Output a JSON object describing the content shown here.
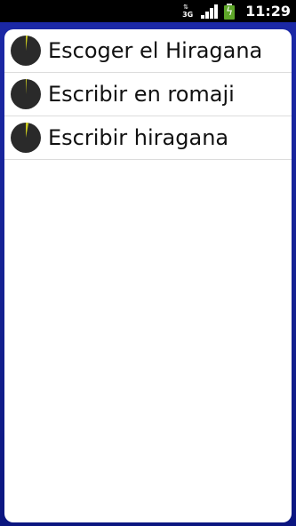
{
  "status_bar": {
    "network_label": "3G",
    "network_arrows": "⇅",
    "time": "11:29",
    "battery_icon": "battery-charging-icon",
    "signal_icon": "signal-bars-icon"
  },
  "menu": {
    "items": [
      {
        "label": "Escoger el Hiragana",
        "progress": 0.02
      },
      {
        "label": "Escribir en romaji",
        "progress": 0.01
      },
      {
        "label": "Escribir hiragana",
        "progress": 0.03
      }
    ]
  },
  "colors": {
    "background": "#13208f",
    "pie_dark": "#2a2a2a",
    "pie_progress": "#c8c81e"
  }
}
